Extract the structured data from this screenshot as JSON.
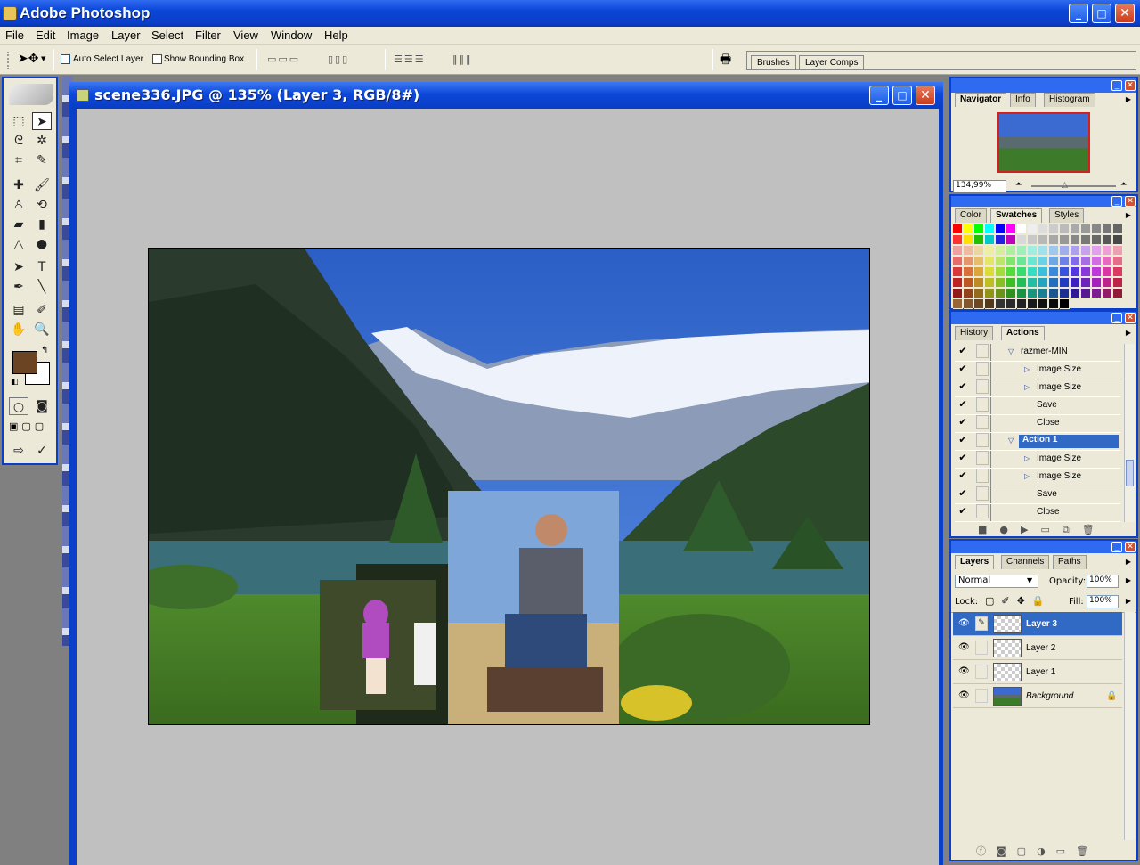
{
  "app": {
    "title": "Adobe Photoshop",
    "window_controls": {
      "minimize": "_",
      "maximize": "□",
      "close": "✕"
    }
  },
  "menu": [
    "File",
    "Edit",
    "Image",
    "Layer",
    "Select",
    "Filter",
    "View",
    "Window",
    "Help"
  ],
  "options_bar": {
    "auto_select_label": "Auto Select Layer",
    "show_bounding_label": "Show Bounding Box",
    "well_tabs": [
      "Brushes",
      "Layer Comps"
    ]
  },
  "document": {
    "title": "scene336.JPG @ 135% (Layer 3, RGB/8#)"
  },
  "toolbox": {
    "colors": {
      "foreground": "#6b4424",
      "background": "#ffffff"
    }
  },
  "navigator": {
    "tabs": [
      "Navigator",
      "Info",
      "Histogram"
    ],
    "zoom": "134,99%"
  },
  "swatches": {
    "tabs": [
      "Color",
      "Swatches",
      "Styles"
    ]
  },
  "actions": {
    "tabs": [
      "History",
      "Actions"
    ],
    "rows": [
      {
        "label": "razmer-MIN",
        "indent": 1,
        "expanded": true,
        "selected": false
      },
      {
        "label": "Image Size",
        "indent": 2,
        "expandable": true,
        "selected": false
      },
      {
        "label": "Image Size",
        "indent": 2,
        "expandable": true,
        "selected": false
      },
      {
        "label": "Save",
        "indent": 2,
        "expandable": false,
        "selected": false
      },
      {
        "label": "Close",
        "indent": 2,
        "expandable": false,
        "selected": false
      },
      {
        "label": "Action 1",
        "indent": 1,
        "expanded": true,
        "selected": true
      },
      {
        "label": "Image Size",
        "indent": 2,
        "expandable": true,
        "selected": false
      },
      {
        "label": "Image Size",
        "indent": 2,
        "expandable": true,
        "selected": false
      },
      {
        "label": "Save",
        "indent": 2,
        "expandable": false,
        "selected": false
      },
      {
        "label": "Close",
        "indent": 2,
        "expandable": false,
        "selected": false
      }
    ]
  },
  "layers": {
    "tabs": [
      "Layers",
      "Channels",
      "Paths"
    ],
    "blend_mode": "Normal",
    "opacity_label": "Opacity:",
    "opacity": "100%",
    "lock_label": "Lock:",
    "fill_label": "Fill:",
    "fill": "100%",
    "items": [
      {
        "name": "Layer 3",
        "selected": true
      },
      {
        "name": "Layer 2",
        "selected": false
      },
      {
        "name": "Layer 1",
        "selected": false
      },
      {
        "name": "Background",
        "selected": false,
        "locked": true
      }
    ]
  },
  "colors": {
    "xp_blue": "#0a3fc8",
    "panel_bg": "#ece9d8",
    "selection": "#316ac5"
  }
}
